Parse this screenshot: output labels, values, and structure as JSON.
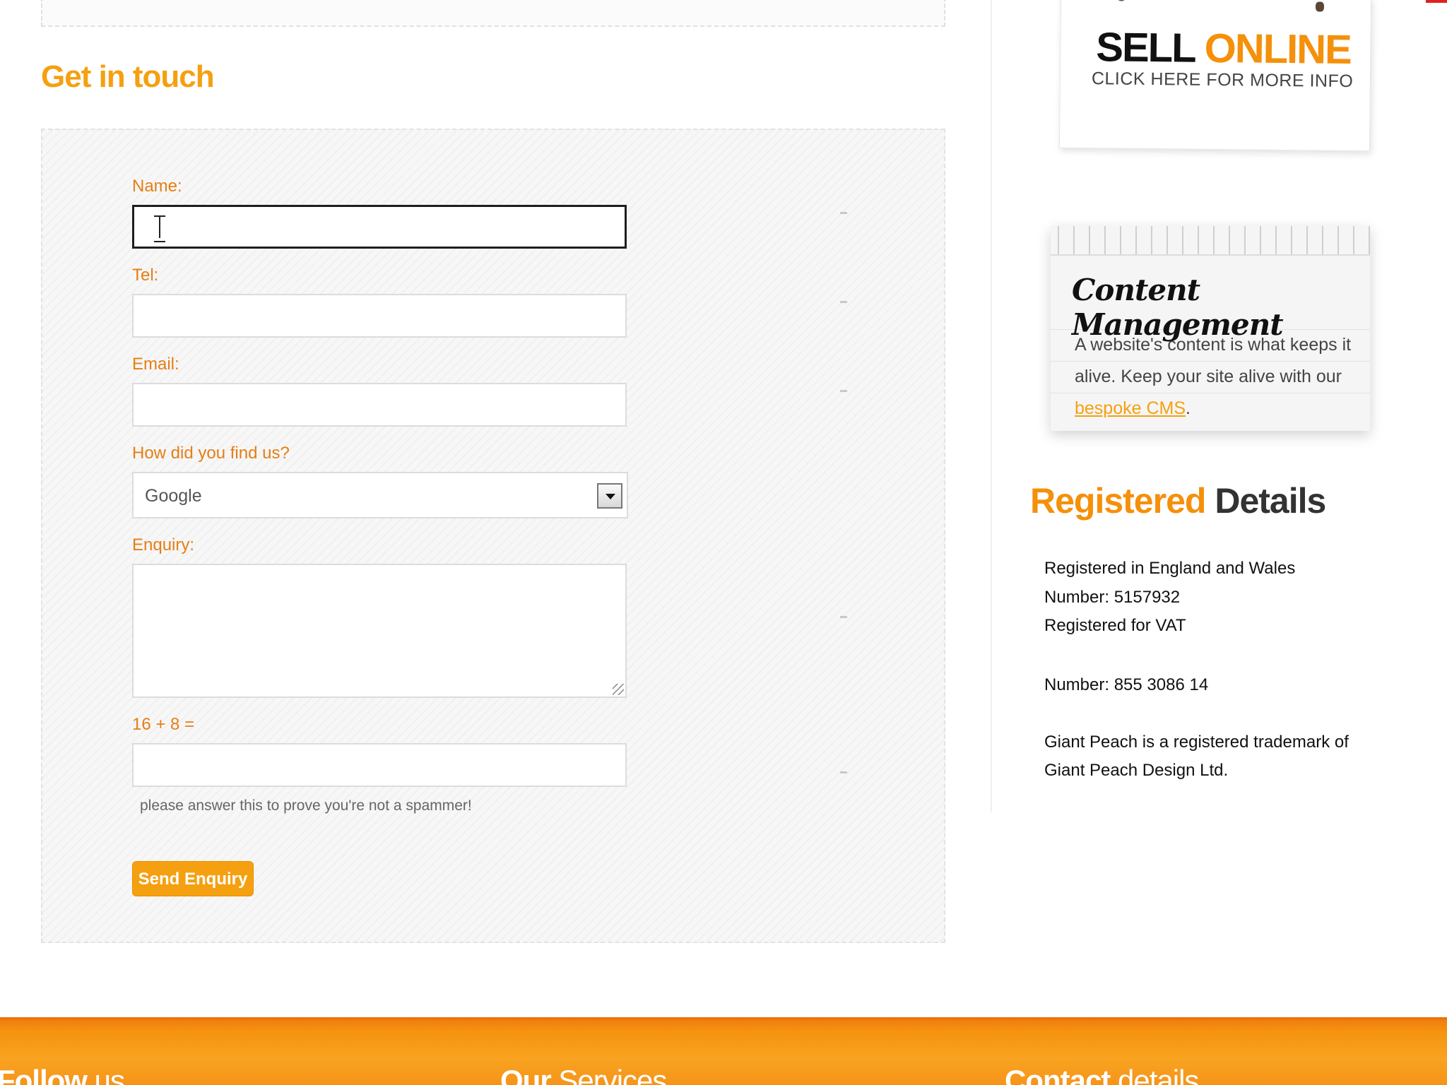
{
  "contact": {
    "title": "Get in touch",
    "fields": {
      "name_label": "Name:",
      "tel_label": "Tel:",
      "email_label": "Email:",
      "source_label": "How did you find us?",
      "source_value": "Google",
      "enquiry_label": "Enquiry:",
      "captcha_label": "16 + 8 =",
      "captcha_hint": "please answer this to prove you're not a spammer!"
    },
    "submit_label": "Send Enquiry"
  },
  "sidebar": {
    "sell_online": {
      "line1": "SELL",
      "line2": "ONLINE",
      "sub": "CLICK HERE FOR MORE INFO"
    },
    "cms": {
      "title": "Content Management",
      "text": "A website's content is what keeps it alive. Keep your site alive with our",
      "link": "bespoke CMS",
      "end": "."
    },
    "registered": {
      "title_a": "Registered",
      "title_b": "Details",
      "lines": [
        "Registered in England and Wales",
        "Number: 5157932",
        "Registered for VAT",
        "Number: 855 3086 14",
        "Giant Peach is a registered trademark of",
        "Giant Peach Design Ltd."
      ]
    }
  },
  "footer": {
    "col1_a": "Follow",
    "col1_b": "us",
    "col2_a": "Our",
    "col2_b": "Services",
    "col3_a": "Contact",
    "col3_b": "details"
  },
  "colors": {
    "accent": "#f5a010",
    "label": "#e67e14"
  }
}
